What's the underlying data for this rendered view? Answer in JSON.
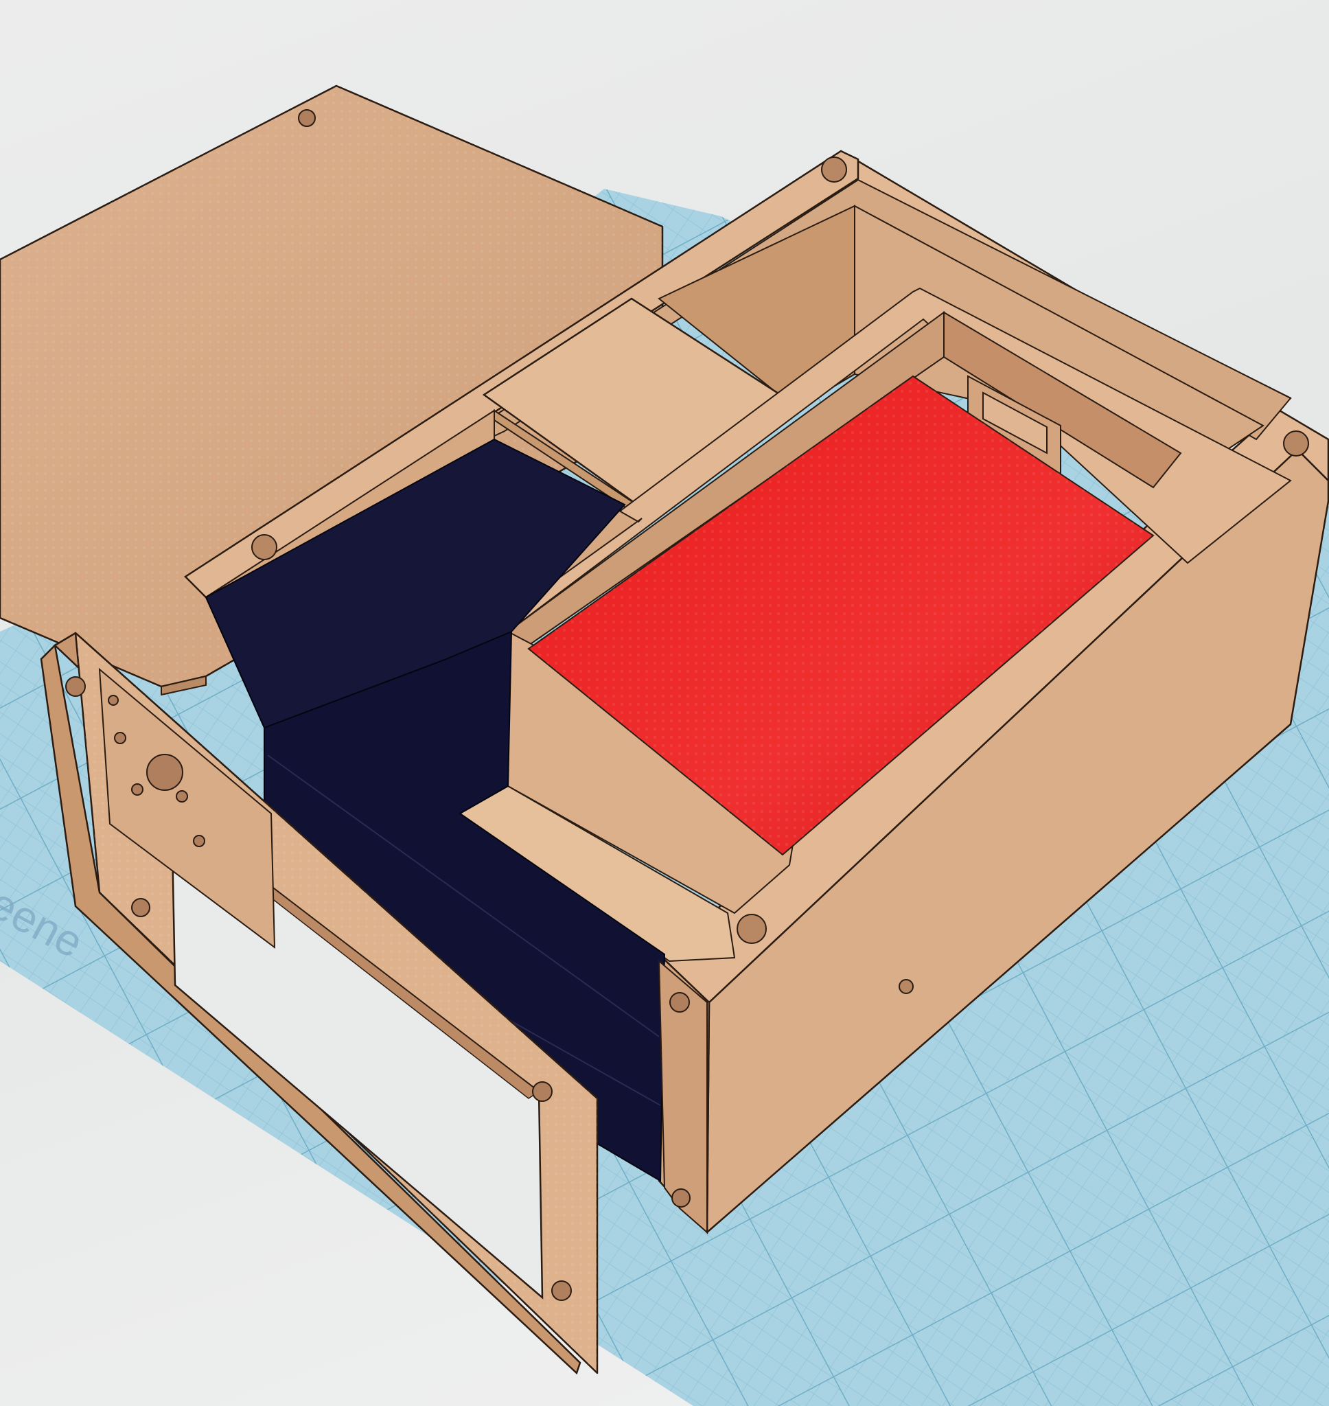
{
  "app": {
    "workplane_label": "eene"
  },
  "colors": {
    "background": "#e9eaea",
    "workplane": "#a9d3e3",
    "grid_minor": "#8fc3d6",
    "grid_major": "#6faec6",
    "enclosure": "#d9ae88",
    "enclosure_light": "#e6bf9a",
    "enclosure_dark": "#c29270",
    "enclosure_inner": "#cf9f7a",
    "display": "#ee2424",
    "battery": "#111133",
    "outline": "#2a1c12"
  },
  "objects": [
    {
      "name": "lid-panel"
    },
    {
      "name": "enclosure-body"
    },
    {
      "name": "front-bezel"
    },
    {
      "name": "red-display-block"
    },
    {
      "name": "navy-battery-block"
    }
  ]
}
